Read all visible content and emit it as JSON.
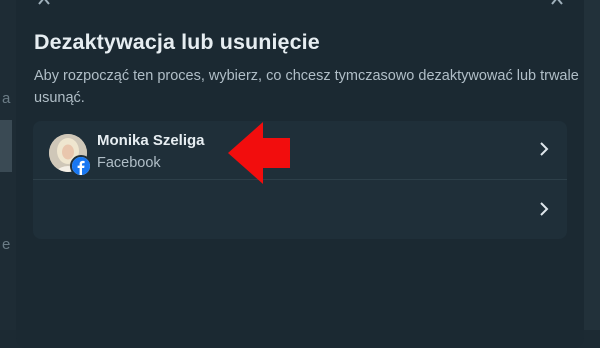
{
  "dialog": {
    "title": "Dezaktywacja lub usunięcie",
    "description": "Aby rozpocząć ten proces, wybierz, co chcesz tymczasowo dezaktywować lub trwale usunąć."
  },
  "accounts": [
    {
      "name": "Monika Szeliga",
      "platform": "Facebook",
      "icon": "facebook-icon"
    },
    {
      "name": "",
      "platform": ""
    }
  ],
  "background": {
    "edge_letters": [
      "a",
      "e"
    ]
  },
  "annotation": {
    "icon": "red-arrow-icon",
    "color": "#f20d0d"
  },
  "colors": {
    "modal_bg": "#1b2932",
    "card_bg": "#1f2f39",
    "title_text": "#e6edf1",
    "secondary_text": "#b0bec7",
    "facebook_blue": "#1877f2"
  }
}
